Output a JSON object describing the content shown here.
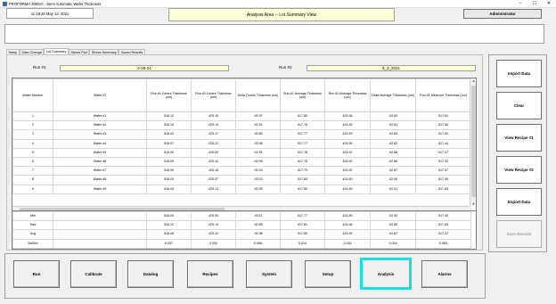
{
  "window": {
    "title": "PROFORMA 300iSA - Semi Automatic Wafer Thickness",
    "minimize": "–",
    "maximize": "☐",
    "close": "✕"
  },
  "header": {
    "clock": "11:19:28  May 13, 2021",
    "view_title": "Analysis Area -- Lot Summary View",
    "admin_label": "Administrator"
  },
  "tabs": [
    {
      "label": "Setup"
    },
    {
      "label": "Data Change"
    },
    {
      "label": "Lot Summary"
    },
    {
      "label": "Stress Plot"
    },
    {
      "label": "Stress Summary"
    },
    {
      "label": "Saved Results"
    }
  ],
  "runs": {
    "run1_label": "Run #1",
    "run1_value": "4-26-21",
    "run2_label": "Run #2",
    "run2_value": "5_3_2021"
  },
  "grid": {
    "headers": [
      "Wafer Number",
      "Wafer ID",
      "Run #1 Centre Thickness (um)",
      "Run #2 Centre Thickness (um)",
      "Delta Centre Thickness (um)",
      "Run #1 Average Thickness (um)",
      "Run #2 Average Thickness (um)",
      "Delta Average Thickness (um)",
      "Run #1 Minimum Thickness (um)"
    ],
    "rows": [
      [
        "1",
        "Wafer #1",
        "518.12",
        "425.15",
        "-92.97",
        "517.80",
        "424.96",
        "-92.83",
        "517.61"
      ],
      [
        "2",
        "Wafer #2",
        "518.10",
        "425.19",
        "-92.91",
        "517.76",
        "424.95",
        "-92.81",
        "517.56"
      ],
      [
        "3",
        "Wafer #3",
        "518.02",
        "425.17",
        "-92.85",
        "517.77",
        "424.93",
        "-92.84",
        "517.60"
      ],
      [
        "4",
        "Wafer #4",
        "518.07",
        "425.12",
        "-92.95",
        "517.77",
        "424.95",
        "-92.82",
        "517.44"
      ],
      [
        "5",
        "Wafer #5",
        "518.00",
        "425.09",
        "-92.91",
        "517.78",
        "424.92",
        "-92.86",
        "517.47"
      ],
      [
        "6",
        "Wafer #6",
        "518.09",
        "425.10",
        "-92.99",
        "517.78",
        "424.92",
        "-92.86",
        "517.42"
      ],
      [
        "7",
        "Wafer #7",
        "518.09",
        "425.16",
        "-92.93",
        "517.79",
        "424.92",
        "-92.87",
        "517.47"
      ],
      [
        "8",
        "Wafer #8",
        "518.09",
        "425.07",
        "-93.02",
        "517.80",
        "424.90",
        "-92.90",
        "517.49"
      ],
      [
        "9",
        "Wafer #9",
        "518.09",
        "425.14",
        "-92.95",
        "517.80",
        "424.90",
        "-92.91",
        "517.69"
      ]
    ]
  },
  "stats": {
    "rows": [
      [
        "Min",
        "",
        "518.00",
        "425.00",
        "-93.11",
        "517.77",
        "424.89",
        "-92.93",
        "517.40"
      ],
      [
        "Max",
        "",
        "518.12",
        "425.19",
        "-92.85",
        "517.81",
        "424.96",
        "-92.80",
        "517.69"
      ],
      [
        "Avg",
        "",
        "518.08",
        "425.12",
        "-92.96",
        "517.80",
        "424.92",
        "-92.87",
        "517.47"
      ],
      [
        "StdDev",
        "",
        "0.037",
        "0.054",
        "0.066",
        "0.014",
        "0.018",
        "0.034",
        "0.083"
      ]
    ]
  },
  "side_buttons": [
    {
      "label": "Import Data",
      "enabled": true
    },
    {
      "label": "Clear",
      "enabled": true
    },
    {
      "label": "View Recipe #1",
      "enabled": true
    },
    {
      "label": "View Recipe #2",
      "enabled": true
    },
    {
      "label": "Export Data",
      "enabled": true
    },
    {
      "label": "Save Results",
      "enabled": false
    }
  ],
  "nav_buttons": [
    {
      "label": "Run"
    },
    {
      "label": "Calibrate"
    },
    {
      "label": "Datalog"
    },
    {
      "label": "Recipes"
    },
    {
      "label": "System"
    },
    {
      "label": "Setup"
    },
    {
      "label": "Analysis",
      "active": true
    },
    {
      "label": "Alarms"
    }
  ],
  "colors": {
    "highlight": "#17e0e8",
    "info_bg": "#ffffd8"
  }
}
